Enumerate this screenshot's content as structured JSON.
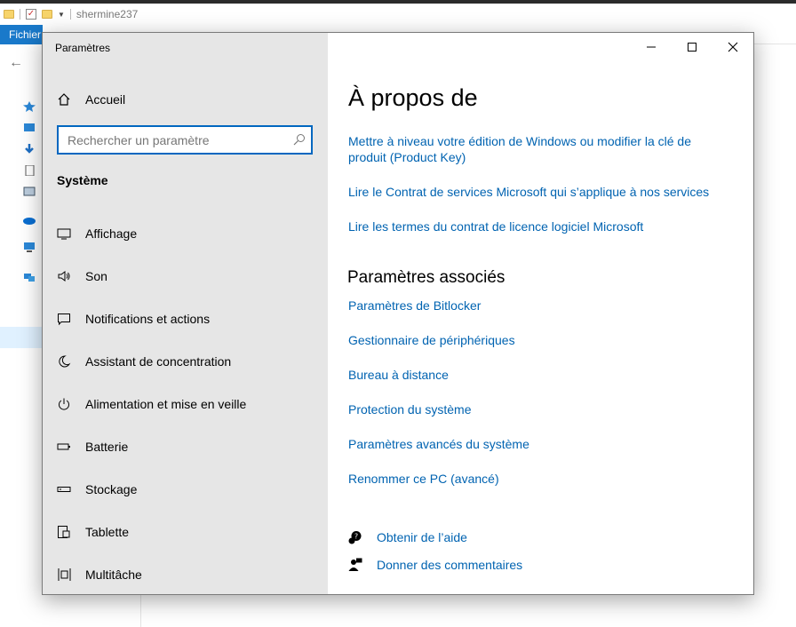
{
  "explorer": {
    "title": "shermine237",
    "ribbon_tab": "Fichier"
  },
  "settings": {
    "window_title": "Paramètres",
    "home_label": "Accueil",
    "search_placeholder": "Rechercher un paramètre",
    "section_title": "Système",
    "nav": [
      {
        "label": "Affichage",
        "icon": "monitor-icon"
      },
      {
        "label": "Son",
        "icon": "speaker-icon"
      },
      {
        "label": "Notifications et actions",
        "icon": "notification-icon"
      },
      {
        "label": "Assistant de concentration",
        "icon": "moon-icon"
      },
      {
        "label": "Alimentation et mise en veille",
        "icon": "power-icon"
      },
      {
        "label": "Batterie",
        "icon": "battery-icon"
      },
      {
        "label": "Stockage",
        "icon": "storage-icon"
      },
      {
        "label": "Tablette",
        "icon": "tablet-icon"
      },
      {
        "label": "Multitâche",
        "icon": "multitask-icon"
      }
    ],
    "content": {
      "title": "À propos de",
      "top_links": [
        "Mettre à niveau votre édition de Windows ou modifier la clé de produit (Product Key)",
        "Lire le Contrat de services Microsoft qui s’applique à nos services",
        "Lire les termes du contrat de licence logiciel Microsoft"
      ],
      "related_title": "Paramètres associés",
      "related_links": [
        "Paramètres de Bitlocker",
        "Gestionnaire de périphériques",
        "Bureau à distance",
        "Protection du système",
        "Paramètres avancés du système",
        "Renommer ce PC (avancé)"
      ],
      "help": "Obtenir de l’aide",
      "feedback": "Donner des commentaires"
    },
    "colors": {
      "accent": "#0067c0",
      "link": "#0063b1",
      "sidebar_bg": "#e6e6e6"
    }
  }
}
